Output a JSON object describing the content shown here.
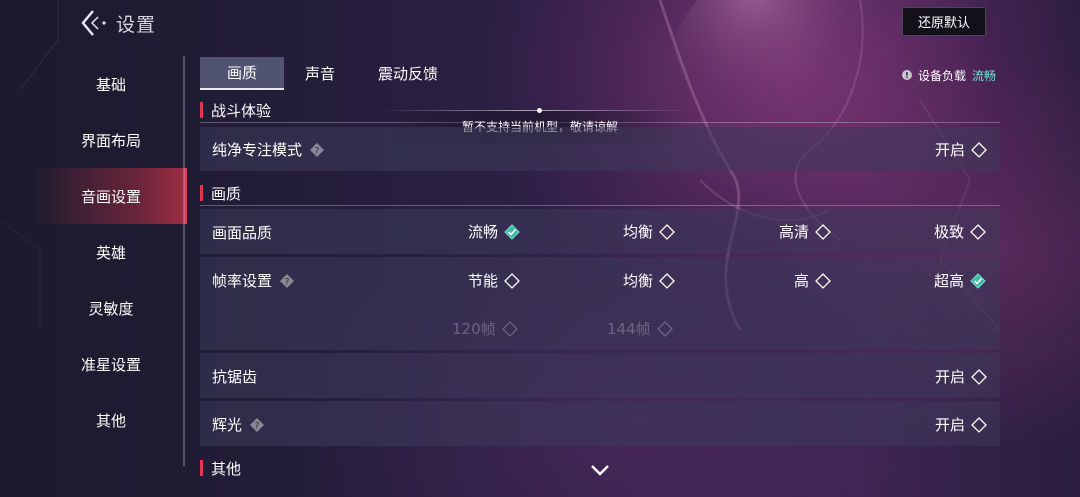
{
  "header": {
    "title": "设置",
    "reset_label": "还原默认"
  },
  "sidebar": {
    "items": [
      {
        "label": "基础"
      },
      {
        "label": "界面布局"
      },
      {
        "label": "音画设置",
        "active": true
      },
      {
        "label": "英雄"
      },
      {
        "label": "灵敏度"
      },
      {
        "label": "准星设置"
      },
      {
        "label": "其他"
      }
    ]
  },
  "tabs": [
    {
      "label": "画质",
      "active": true
    },
    {
      "label": "声音"
    },
    {
      "label": "震动反馈"
    }
  ],
  "device_load": {
    "label": "设备负载",
    "value": "流畅",
    "value_color": "#6fe3cf"
  },
  "toast": {
    "text": "暂不支持当前机型，敬请谅解"
  },
  "sections": {
    "battle": {
      "title": "战斗体验",
      "pure_focus": {
        "label": "纯净专注模式",
        "option": "开启",
        "selected": false
      }
    },
    "quality": {
      "title": "画质",
      "image_quality": {
        "label": "画面品质",
        "options": [
          {
            "label": "流畅",
            "selected": true
          },
          {
            "label": "均衡",
            "selected": false
          },
          {
            "label": "高清",
            "selected": false
          },
          {
            "label": "极致",
            "selected": false
          }
        ]
      },
      "frame_rate": {
        "label": "帧率设置",
        "options": [
          {
            "label": "节能",
            "selected": false
          },
          {
            "label": "均衡",
            "selected": false
          },
          {
            "label": "高",
            "selected": false
          },
          {
            "label": "超高",
            "selected": true
          }
        ],
        "extra_options": [
          {
            "label": "120帧",
            "disabled": true
          },
          {
            "label": "144帧",
            "disabled": true
          }
        ]
      },
      "anti_alias": {
        "label": "抗锯齿",
        "option": "开启",
        "selected": false
      },
      "glow": {
        "label": "辉光",
        "option": "开启",
        "selected": false
      }
    },
    "other": {
      "title": "其他"
    }
  },
  "colors": {
    "accent_red": "#e0374f",
    "selected_teal": "#6fe3cf",
    "row_bg": "#3c3a5a"
  },
  "icons": {
    "back": "chevron-left-icon",
    "help": "question-diamond-icon",
    "diamond_empty": "diamond-outline-icon",
    "diamond_checked": "diamond-check-icon",
    "scroll_down": "chevron-down-icon"
  }
}
